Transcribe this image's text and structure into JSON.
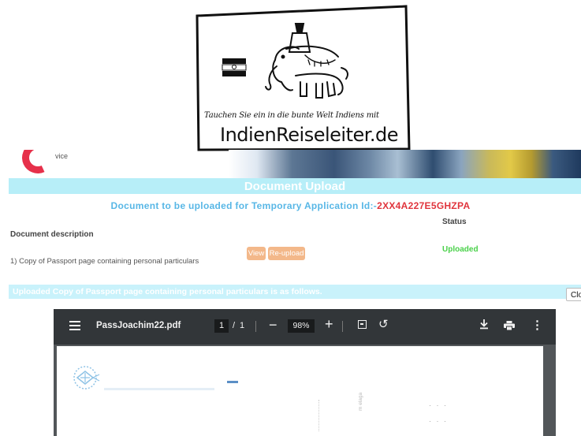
{
  "logo": {
    "tagline": "Tauchen Sie ein in die bunte Welt Indiens mit",
    "brand": "IndienReiseleiter.de"
  },
  "site": {
    "fragment_text": "vice"
  },
  "upload": {
    "title": "Document Upload",
    "app_label": "Document to be uploaded for Temporary Application Id:-",
    "app_id": "2XX4A227E5GHZPA",
    "status_header": "Status",
    "desc_header": "Document description",
    "item_label": "1) Copy of Passport page containing personal particulars",
    "view_label": "View",
    "reupload_label": "Re-upload",
    "status_value": "Uploaded",
    "note": "Uploaded Copy of Passport page containing personal particulars is as follows.",
    "close_label": "Clo"
  },
  "pdf": {
    "filename": "PassJoachim22.pdf",
    "page_current": "1",
    "page_separator": "/",
    "page_total": "1",
    "zoom_out": "−",
    "zoom": "98%",
    "zoom_in": "+",
    "rotate_icon": "↺",
    "more_icon": "⋮",
    "page_side_text": "m elaga"
  },
  "colors": {
    "title_bar": "#b7eef8",
    "app_line": "#58b7e6",
    "app_id": "#e0343c",
    "button": "#f3b88a",
    "status_ok": "#4ad14a",
    "pdf_toolbar": "#323639"
  }
}
